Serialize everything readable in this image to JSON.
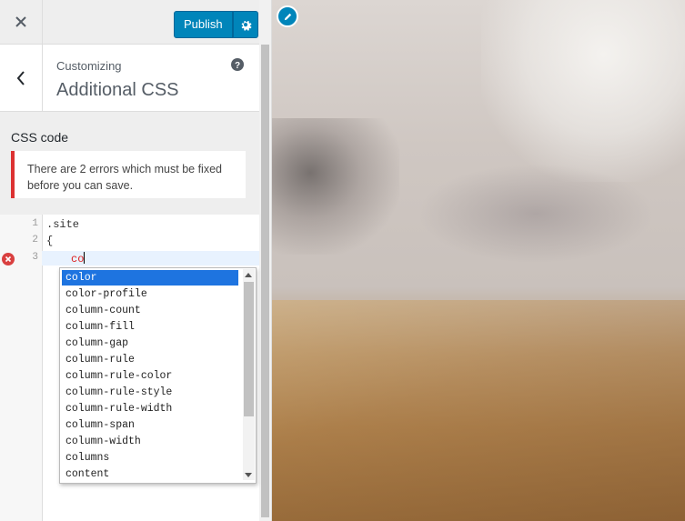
{
  "header": {
    "publish_label": "Publish"
  },
  "section": {
    "breadcrumb": "Customizing",
    "title": "Additional CSS"
  },
  "css_code": {
    "label": "CSS code",
    "error_notice": "There are 2 errors which must be fixed before you can save."
  },
  "editor": {
    "line_numbers": [
      "1",
      "2",
      "3"
    ],
    "lines": [
      ".site",
      "{",
      "co"
    ]
  },
  "autocomplete": {
    "items": [
      "color",
      "color-profile",
      "column-count",
      "column-fill",
      "column-gap",
      "column-rule",
      "column-rule-color",
      "column-rule-style",
      "column-rule-width",
      "column-span",
      "column-width",
      "columns",
      "content"
    ],
    "selected": "color"
  },
  "colors": {
    "accent": "#0085ba",
    "error": "#dc3232",
    "selection": "#1e74e0"
  }
}
